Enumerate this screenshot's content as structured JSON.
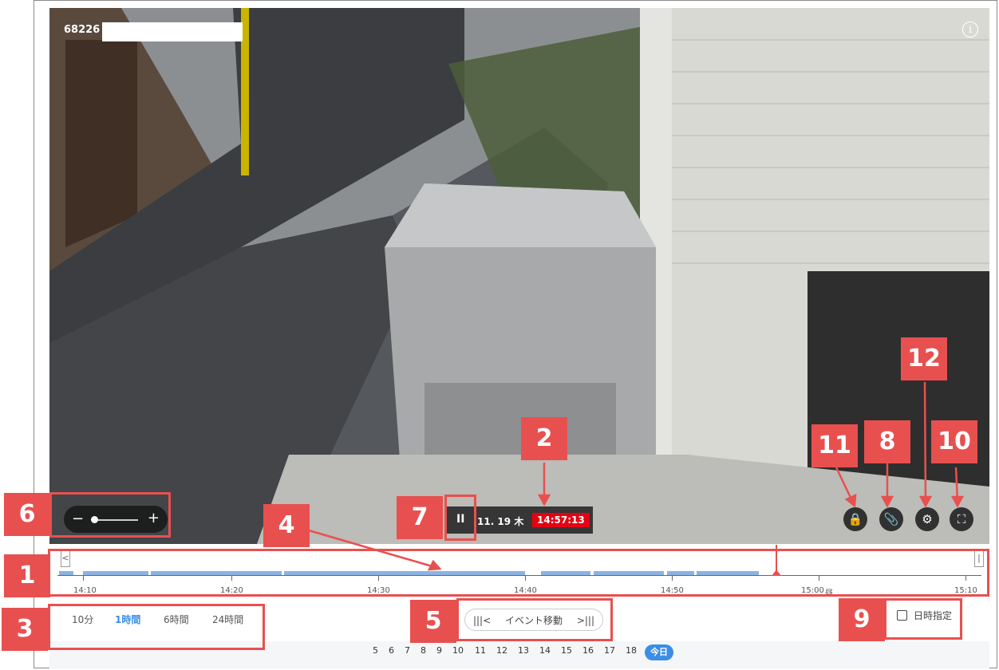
{
  "video": {
    "camera_id": "68226",
    "info_icon": "info-icon"
  },
  "playbar": {
    "pause_icon": "II",
    "date": "11. 19 木",
    "time": "14:57:13"
  },
  "zoom": {
    "minus": "−",
    "plus": "+",
    "level": 0.1
  },
  "controls": {
    "lock_icon": "lock-icon",
    "clip_icon": "paperclip-icon",
    "settings_icon": "gear-icon",
    "fullscreen_icon": "fullscreen-icon"
  },
  "timeline": {
    "labels": [
      "14:10",
      "14:20",
      "14:30",
      "14:40",
      "14:50",
      "15:00",
      "15:10"
    ],
    "noon_marker": "昼",
    "left_arrow": "<",
    "right_arrow": "|"
  },
  "scale": {
    "options": [
      "10分",
      "1時間",
      "6時間",
      "24時間"
    ],
    "selected": "1時間"
  },
  "event_nav": {
    "prev": "|||<",
    "label": "イベント移動",
    "next": ">|||"
  },
  "datetime_button": "日時指定",
  "days": [
    "5",
    "6",
    "7",
    "8",
    "9",
    "10",
    "11",
    "12",
    "13",
    "14",
    "15",
    "16",
    "17",
    "18"
  ],
  "today_label": "今日",
  "annotations": [
    "1",
    "2",
    "3",
    "4",
    "5",
    "6",
    "7",
    "8",
    "9",
    "10",
    "11",
    "12"
  ],
  "colors": {
    "accent": "#3a8ee6",
    "badge": "#e8504f",
    "time_box": "#e60012",
    "recording_segment": "#89b4e2"
  }
}
